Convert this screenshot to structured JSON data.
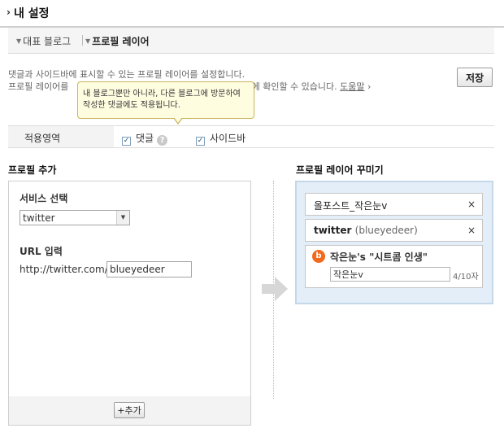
{
  "header": {
    "title": "내 설정"
  },
  "tabs": [
    {
      "label": "대표 블로그"
    },
    {
      "label": "프로필 레이어"
    }
  ],
  "description": {
    "line1": "댓글과 사이드바에 표시할 수 있는 프로필 레이어를 설정합니다.",
    "line2_start": "프로필 레이어를",
    "line2_end": "한눈에 확인할 수 있습니다.",
    "help_link": "도움말"
  },
  "save_button": "저장",
  "tooltip": {
    "line1": "내 블로그뿐만 아니라, 다른 블로그에 방문하여",
    "line2": "작성한 댓글에도 적용됩니다."
  },
  "apply_area": {
    "label": "적용영역",
    "options": [
      {
        "label": "댓글",
        "checked": true
      },
      {
        "label": "사이드바",
        "checked": true
      }
    ]
  },
  "add_profile": {
    "title": "프로필 추가",
    "service_label": "서비스 선택",
    "service_selected": "twitter",
    "url_label": "URL 입력",
    "url_prefix": "http://twitter.com/",
    "url_value": "blueyedeer",
    "add_button": "+추가"
  },
  "decorate": {
    "title": "프로필 레이어 꾸미기",
    "items": [
      {
        "name": "올포스트_작은눈v"
      },
      {
        "name": "twitter",
        "sub": "(blueyedeer)"
      }
    ],
    "blog_item": {
      "title": "작은눈's \"시트콤 인생\"",
      "nickname": "작은눈v",
      "counter": "4/10자"
    }
  }
}
